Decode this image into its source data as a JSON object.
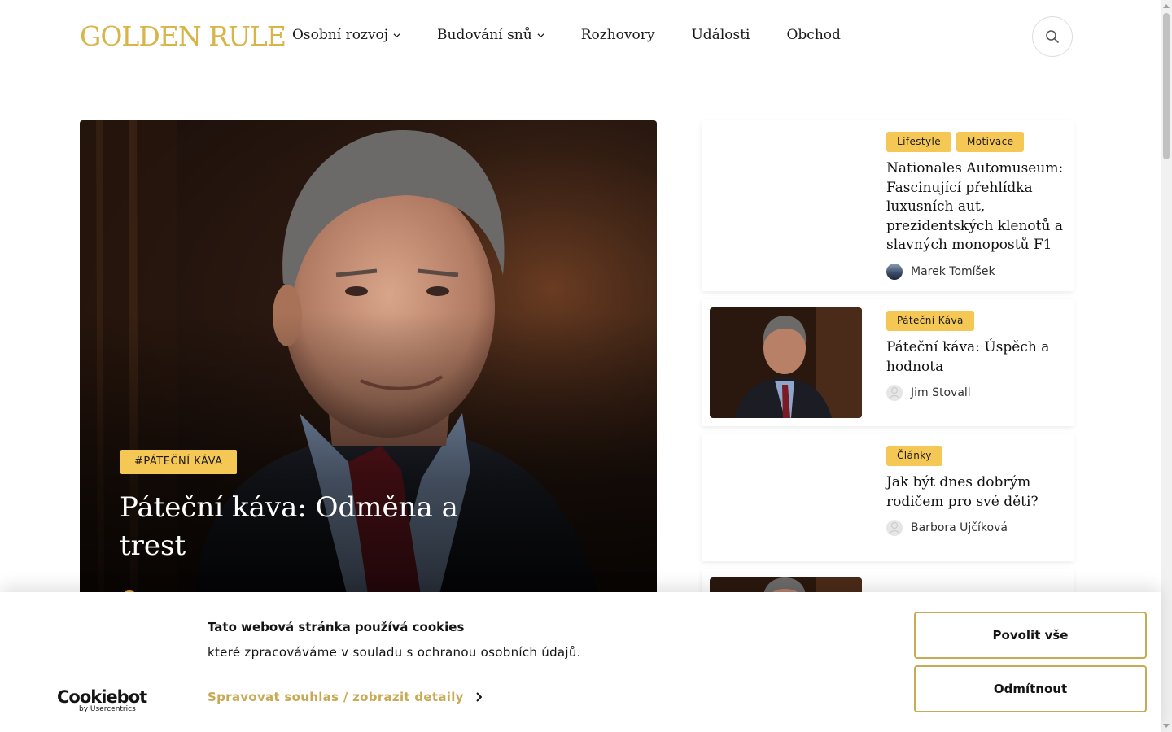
{
  "header": {
    "logo_text": "GOLDEN RULE",
    "nav": [
      {
        "label": "Osobní rozvoj",
        "has_dropdown": true
      },
      {
        "label": "Budování snů",
        "has_dropdown": true
      },
      {
        "label": "Rozhovory",
        "has_dropdown": false
      },
      {
        "label": "Události",
        "has_dropdown": false
      },
      {
        "label": "Obchod",
        "has_dropdown": false
      }
    ],
    "search_icon": "search-icon"
  },
  "hero": {
    "tag": "#PÁTEČNÍ KÁVA",
    "title": "Páteční káva: Odměna a trest"
  },
  "cards": [
    {
      "tags": [
        "Lifestyle",
        "Motivace"
      ],
      "title": "Nationales Automuseum: Fascinující přehlídka luxusních aut, prezidentských klenotů a slavných monopostů F1",
      "author": "Marek Tomíšek",
      "has_image": false
    },
    {
      "tags": [
        "Páteční Káva"
      ],
      "title": "Páteční káva: Úspěch a hodnota",
      "author": "Jim Stovall",
      "has_image": true
    },
    {
      "tags": [
        "Články"
      ],
      "title": "Jak být dnes dobrým rodičem pro své děti?",
      "author": "Barbora Ujčíková",
      "has_image": false
    }
  ],
  "cookie": {
    "brand_main": "Cookiebot",
    "brand_sub": "by Usercentrics",
    "title": "Tato webová stránka používá cookies",
    "text": "které zpracováváme v souladu s ochranou osobních údajů.",
    "link": "Spravovat souhlas / zobrazit detaily",
    "accept_button": "Povolit vše",
    "reject_button": "Odmítnout"
  },
  "colors": {
    "accent_gold": "#d8b54a",
    "tag_yellow": "#f5c855",
    "cookie_gold": "#c8a954"
  }
}
